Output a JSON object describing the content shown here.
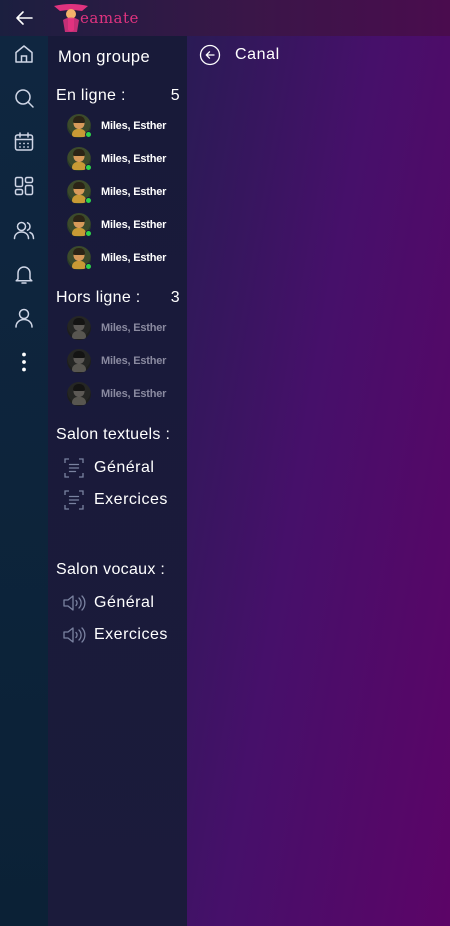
{
  "app": {
    "logo_text": "eamate"
  },
  "rail": {
    "icons": [
      "home-icon",
      "search-icon",
      "calendar-icon",
      "dashboard-icon",
      "users-icon",
      "bell-icon",
      "user-icon",
      "more-vertical-icon"
    ]
  },
  "panel": {
    "title": "Mon groupe",
    "online": {
      "label": "En ligne :",
      "count": "5",
      "members": [
        "Miles, Esther",
        "Miles, Esther",
        "Miles, Esther",
        "Miles, Esther",
        "Miles, Esther"
      ]
    },
    "offline": {
      "label": "Hors ligne :",
      "count": "3",
      "members": [
        "Miles, Esther",
        "Miles, Esther",
        "Miles, Esther"
      ]
    },
    "text_channels": {
      "label": "Salon textuels :",
      "items": [
        "Général",
        "Exercices"
      ]
    },
    "voice_channels": {
      "label": "Salon vocaux :",
      "items": [
        "Général",
        "Exercices"
      ]
    }
  },
  "main": {
    "title": "Canal"
  },
  "colors": {
    "accent_logo": "#e0337f",
    "online_dot": "#2ed34a",
    "offline_text": "#8a8aa0"
  }
}
